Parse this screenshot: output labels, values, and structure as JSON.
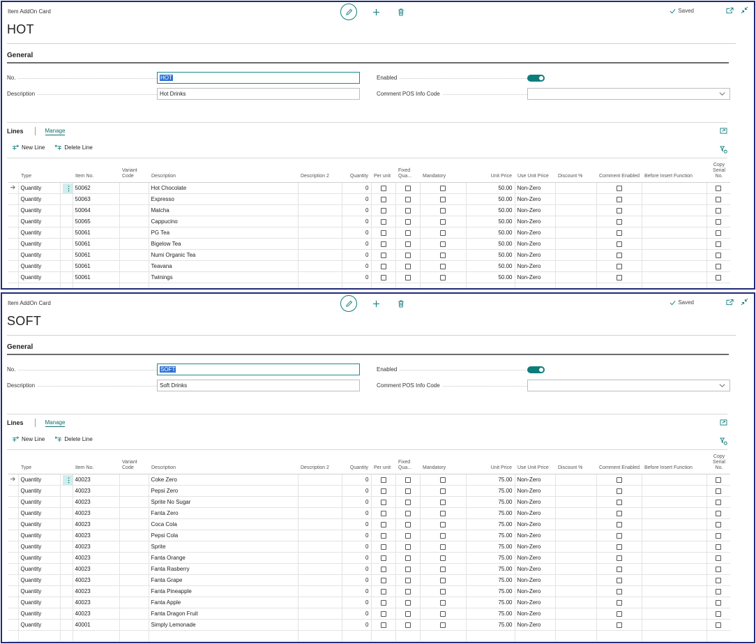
{
  "cards": [
    {
      "page_label": "Item AddOn Card",
      "title": "HOT",
      "status": "Saved",
      "general": {
        "heading": "General",
        "no_label": "No.",
        "no_value": "HOT",
        "description_label": "Description",
        "description_value": "Hot Drinks",
        "enabled_label": "Enabled",
        "enabled": true,
        "comment_label": "Comment POS Info Code",
        "comment_value": ""
      },
      "lines": {
        "title": "Lines",
        "manage_tab": "Manage",
        "new_line": "New Line",
        "delete_line": "Delete Line",
        "columns": [
          "Type",
          "Item No.",
          "Variant Code",
          "Description",
          "Description 2",
          "Quantity",
          "Per unit",
          "Fixed Qua...",
          "Mandatory",
          "Unit Price",
          "Use Unit Price",
          "Discount %",
          "Comment Enabled",
          "Before Insert Function",
          "Copy Serial No."
        ],
        "rows": [
          {
            "type": "Quantity",
            "item_no": "50062",
            "description": "Hot Chocolate",
            "quantity": "0",
            "unit_price": "50.00",
            "use_unit_price": "Non-Zero"
          },
          {
            "type": "Quantity",
            "item_no": "50063",
            "description": "Expresso",
            "quantity": "0",
            "unit_price": "50.00",
            "use_unit_price": "Non-Zero"
          },
          {
            "type": "Quantity",
            "item_no": "50064",
            "description": "Matcha",
            "quantity": "0",
            "unit_price": "50.00",
            "use_unit_price": "Non-Zero"
          },
          {
            "type": "Quantity",
            "item_no": "50065",
            "description": "Cappucino",
            "quantity": "0",
            "unit_price": "50.00",
            "use_unit_price": "Non-Zero"
          },
          {
            "type": "Quantity",
            "item_no": "50061",
            "description": "PG Tea",
            "quantity": "0",
            "unit_price": "50.00",
            "use_unit_price": "Non-Zero"
          },
          {
            "type": "Quantity",
            "item_no": "50061",
            "description": "Bigelow Tea",
            "quantity": "0",
            "unit_price": "50.00",
            "use_unit_price": "Non-Zero"
          },
          {
            "type": "Quantity",
            "item_no": "50061",
            "description": "Numi Organic Tea",
            "quantity": "0",
            "unit_price": "50.00",
            "use_unit_price": "Non-Zero"
          },
          {
            "type": "Quantity",
            "item_no": "50061",
            "description": "Teavana",
            "quantity": "0",
            "unit_price": "50.00",
            "use_unit_price": "Non-Zero"
          },
          {
            "type": "Quantity",
            "item_no": "50061",
            "description": "Twinings",
            "quantity": "0",
            "unit_price": "50.00",
            "use_unit_price": "Non-Zero"
          }
        ]
      }
    },
    {
      "page_label": "Item AddOn Card",
      "title": "SOFT",
      "status": "Saved",
      "general": {
        "heading": "General",
        "no_label": "No.",
        "no_value": "SOFT",
        "description_label": "Description",
        "description_value": "Soft Drinks",
        "enabled_label": "Enabled",
        "enabled": true,
        "comment_label": "Comment POS Info Code",
        "comment_value": ""
      },
      "lines": {
        "title": "Lines",
        "manage_tab": "Manage",
        "new_line": "New Line",
        "delete_line": "Delete Line",
        "columns": [
          "Type",
          "Item No.",
          "Variant Code",
          "Description",
          "Description 2",
          "Quantity",
          "Per unit",
          "Fixed Qua...",
          "Mandatory",
          "Unit Price",
          "Use Unit Price",
          "Discount %",
          "Comment Enabled",
          "Before Insert Function",
          "Copy Serial No."
        ],
        "rows": [
          {
            "type": "Quantity",
            "item_no": "40023",
            "description": "Coke Zero",
            "quantity": "0",
            "unit_price": "75.00",
            "use_unit_price": "Non-Zero"
          },
          {
            "type": "Quantity",
            "item_no": "40023",
            "description": "Pepsi Zero",
            "quantity": "0",
            "unit_price": "75.00",
            "use_unit_price": "Non-Zero"
          },
          {
            "type": "Quantity",
            "item_no": "40023",
            "description": "Sprite No Sugar",
            "quantity": "0",
            "unit_price": "75.00",
            "use_unit_price": "Non-Zero"
          },
          {
            "type": "Quantity",
            "item_no": "40023",
            "description": "Fanta Zero",
            "quantity": "0",
            "unit_price": "75.00",
            "use_unit_price": "Non-Zero"
          },
          {
            "type": "Quantity",
            "item_no": "40023",
            "description": "Coca Cola",
            "quantity": "0",
            "unit_price": "75.00",
            "use_unit_price": "Non-Zero"
          },
          {
            "type": "Quantity",
            "item_no": "40023",
            "description": "Pepsi Cola",
            "quantity": "0",
            "unit_price": "75.00",
            "use_unit_price": "Non-Zero"
          },
          {
            "type": "Quantity",
            "item_no": "40023",
            "description": "Sprite",
            "quantity": "0",
            "unit_price": "75.00",
            "use_unit_price": "Non-Zero"
          },
          {
            "type": "Quantity",
            "item_no": "40023",
            "description": "Fanta Orange",
            "quantity": "0",
            "unit_price": "75.00",
            "use_unit_price": "Non-Zero"
          },
          {
            "type": "Quantity",
            "item_no": "40023",
            "description": "Fanta Rasberry",
            "quantity": "0",
            "unit_price": "75.00",
            "use_unit_price": "Non-Zero"
          },
          {
            "type": "Quantity",
            "item_no": "40023",
            "description": "Fanta Grape",
            "quantity": "0",
            "unit_price": "75.00",
            "use_unit_price": "Non-Zero"
          },
          {
            "type": "Quantity",
            "item_no": "40023",
            "description": "Fanta Pineapple",
            "quantity": "0",
            "unit_price": "75.00",
            "use_unit_price": "Non-Zero"
          },
          {
            "type": "Quantity",
            "item_no": "40023",
            "description": "Fanta Apple",
            "quantity": "0",
            "unit_price": "75.00",
            "use_unit_price": "Non-Zero"
          },
          {
            "type": "Quantity",
            "item_no": "40023",
            "description": "Fanta Dragon Fruit",
            "quantity": "0",
            "unit_price": "75.00",
            "use_unit_price": "Non-Zero"
          },
          {
            "type": "Quantity",
            "item_no": "40001",
            "description": "Simply Lemonade",
            "quantity": "0",
            "unit_price": "75.00",
            "use_unit_price": "Non-Zero"
          }
        ]
      }
    }
  ],
  "colors": {
    "accent": "#0e7c7b",
    "frame": "#1f2a7a",
    "selection": "#2f6fd1"
  },
  "icons": [
    "edit-icon",
    "plus-icon",
    "delete-icon",
    "checkmark-icon",
    "share-icon",
    "collapse-icon",
    "new-line-icon",
    "delete-line-icon",
    "expand-icon",
    "filter-icon",
    "chevron-down-icon",
    "row-arrow-icon",
    "row-menu-icon"
  ]
}
